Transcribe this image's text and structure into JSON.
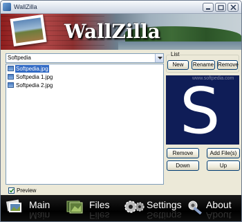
{
  "window": {
    "title": "WallZilla"
  },
  "banner": {
    "logo": "WallZilla"
  },
  "folder": {
    "selected": "Softpedia"
  },
  "files": [
    {
      "name": "Softpedia.jpg",
      "selected": true
    },
    {
      "name": "Softpedia 1.jpg",
      "selected": false
    },
    {
      "name": "Softpedia 2.jpg",
      "selected": false
    }
  ],
  "list_group": {
    "title": "List",
    "new_label": "New",
    "rename_label": "Rename",
    "remove_label": "Remove"
  },
  "preview": {
    "watermark": "www.softpedia.com",
    "letter": "S"
  },
  "image_buttons": {
    "remove_label": "Remove",
    "add_files_label": "Add File(s)",
    "down_label": "Down",
    "up_label": "Up"
  },
  "preview_checkbox": {
    "label": "Preview",
    "checked": true
  },
  "nav": [
    {
      "label": "Main",
      "icon": "photo-stack-icon"
    },
    {
      "label": "Files",
      "icon": "files-icon"
    },
    {
      "label": "Settings",
      "icon": "gears-icon"
    },
    {
      "label": "About",
      "icon": "about-icon"
    }
  ],
  "colors": {
    "selection": "#316ac5",
    "preview_bg": "#0f1d57",
    "nav_bg": "#000000"
  }
}
